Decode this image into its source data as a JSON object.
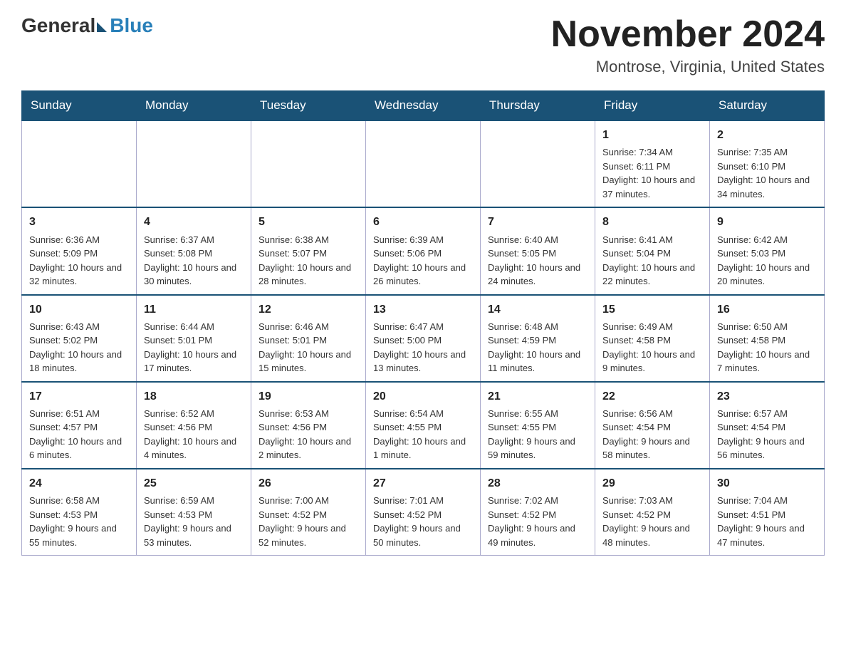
{
  "header": {
    "logo_general": "General",
    "logo_blue": "Blue",
    "month_title": "November 2024",
    "location": "Montrose, Virginia, United States"
  },
  "days_of_week": [
    "Sunday",
    "Monday",
    "Tuesday",
    "Wednesday",
    "Thursday",
    "Friday",
    "Saturday"
  ],
  "weeks": [
    [
      {
        "day": "",
        "info": ""
      },
      {
        "day": "",
        "info": ""
      },
      {
        "day": "",
        "info": ""
      },
      {
        "day": "",
        "info": ""
      },
      {
        "day": "",
        "info": ""
      },
      {
        "day": "1",
        "info": "Sunrise: 7:34 AM\nSunset: 6:11 PM\nDaylight: 10 hours and 37 minutes."
      },
      {
        "day": "2",
        "info": "Sunrise: 7:35 AM\nSunset: 6:10 PM\nDaylight: 10 hours and 34 minutes."
      }
    ],
    [
      {
        "day": "3",
        "info": "Sunrise: 6:36 AM\nSunset: 5:09 PM\nDaylight: 10 hours and 32 minutes."
      },
      {
        "day": "4",
        "info": "Sunrise: 6:37 AM\nSunset: 5:08 PM\nDaylight: 10 hours and 30 minutes."
      },
      {
        "day": "5",
        "info": "Sunrise: 6:38 AM\nSunset: 5:07 PM\nDaylight: 10 hours and 28 minutes."
      },
      {
        "day": "6",
        "info": "Sunrise: 6:39 AM\nSunset: 5:06 PM\nDaylight: 10 hours and 26 minutes."
      },
      {
        "day": "7",
        "info": "Sunrise: 6:40 AM\nSunset: 5:05 PM\nDaylight: 10 hours and 24 minutes."
      },
      {
        "day": "8",
        "info": "Sunrise: 6:41 AM\nSunset: 5:04 PM\nDaylight: 10 hours and 22 minutes."
      },
      {
        "day": "9",
        "info": "Sunrise: 6:42 AM\nSunset: 5:03 PM\nDaylight: 10 hours and 20 minutes."
      }
    ],
    [
      {
        "day": "10",
        "info": "Sunrise: 6:43 AM\nSunset: 5:02 PM\nDaylight: 10 hours and 18 minutes."
      },
      {
        "day": "11",
        "info": "Sunrise: 6:44 AM\nSunset: 5:01 PM\nDaylight: 10 hours and 17 minutes."
      },
      {
        "day": "12",
        "info": "Sunrise: 6:46 AM\nSunset: 5:01 PM\nDaylight: 10 hours and 15 minutes."
      },
      {
        "day": "13",
        "info": "Sunrise: 6:47 AM\nSunset: 5:00 PM\nDaylight: 10 hours and 13 minutes."
      },
      {
        "day": "14",
        "info": "Sunrise: 6:48 AM\nSunset: 4:59 PM\nDaylight: 10 hours and 11 minutes."
      },
      {
        "day": "15",
        "info": "Sunrise: 6:49 AM\nSunset: 4:58 PM\nDaylight: 10 hours and 9 minutes."
      },
      {
        "day": "16",
        "info": "Sunrise: 6:50 AM\nSunset: 4:58 PM\nDaylight: 10 hours and 7 minutes."
      }
    ],
    [
      {
        "day": "17",
        "info": "Sunrise: 6:51 AM\nSunset: 4:57 PM\nDaylight: 10 hours and 6 minutes."
      },
      {
        "day": "18",
        "info": "Sunrise: 6:52 AM\nSunset: 4:56 PM\nDaylight: 10 hours and 4 minutes."
      },
      {
        "day": "19",
        "info": "Sunrise: 6:53 AM\nSunset: 4:56 PM\nDaylight: 10 hours and 2 minutes."
      },
      {
        "day": "20",
        "info": "Sunrise: 6:54 AM\nSunset: 4:55 PM\nDaylight: 10 hours and 1 minute."
      },
      {
        "day": "21",
        "info": "Sunrise: 6:55 AM\nSunset: 4:55 PM\nDaylight: 9 hours and 59 minutes."
      },
      {
        "day": "22",
        "info": "Sunrise: 6:56 AM\nSunset: 4:54 PM\nDaylight: 9 hours and 58 minutes."
      },
      {
        "day": "23",
        "info": "Sunrise: 6:57 AM\nSunset: 4:54 PM\nDaylight: 9 hours and 56 minutes."
      }
    ],
    [
      {
        "day": "24",
        "info": "Sunrise: 6:58 AM\nSunset: 4:53 PM\nDaylight: 9 hours and 55 minutes."
      },
      {
        "day": "25",
        "info": "Sunrise: 6:59 AM\nSunset: 4:53 PM\nDaylight: 9 hours and 53 minutes."
      },
      {
        "day": "26",
        "info": "Sunrise: 7:00 AM\nSunset: 4:52 PM\nDaylight: 9 hours and 52 minutes."
      },
      {
        "day": "27",
        "info": "Sunrise: 7:01 AM\nSunset: 4:52 PM\nDaylight: 9 hours and 50 minutes."
      },
      {
        "day": "28",
        "info": "Sunrise: 7:02 AM\nSunset: 4:52 PM\nDaylight: 9 hours and 49 minutes."
      },
      {
        "day": "29",
        "info": "Sunrise: 7:03 AM\nSunset: 4:52 PM\nDaylight: 9 hours and 48 minutes."
      },
      {
        "day": "30",
        "info": "Sunrise: 7:04 AM\nSunset: 4:51 PM\nDaylight: 9 hours and 47 minutes."
      }
    ]
  ]
}
